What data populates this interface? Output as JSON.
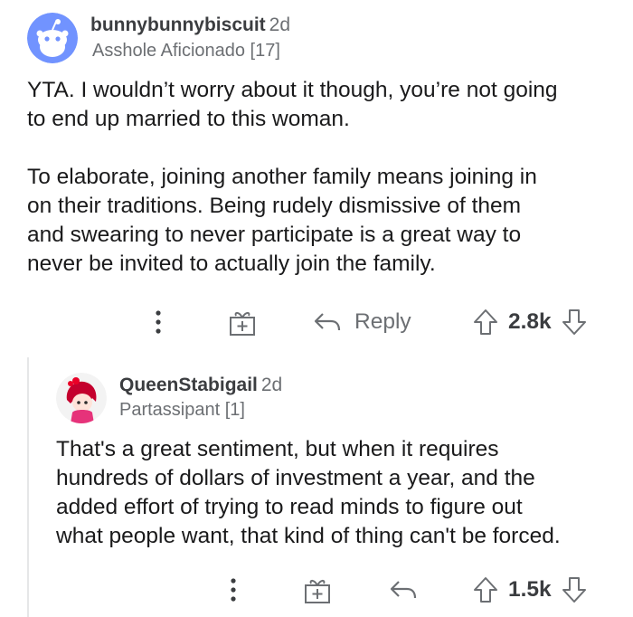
{
  "comments": [
    {
      "username": "bunnybunnybiscuit",
      "age": "2d",
      "flair": "Asshole Aficionado [17]",
      "paragraphs": [
        "YTA. I wouldn’t worry about it though, you’re not going\nto end up married to this woman.",
        "To elaborate, joining another family means joining in\non their traditions. Being rudely dismissive of them\nand swearing to never participate is a great way to\nnever be invited to actually join the family."
      ],
      "reply_label": "Reply",
      "score": "2.8k",
      "avatar_color": "#7193ff"
    },
    {
      "username": "QueenStabigail",
      "age": "2d",
      "flair": "Partassipant [1]",
      "paragraphs": [
        "That's a great sentiment, but when it requires\nhundreds of dollars of investment a year, and the\nadded effort of trying to read minds to figure out\nwhat people want, that kind of thing can't be forced."
      ],
      "score": "1.5k",
      "avatar_color": "#ea0027"
    }
  ],
  "icons": {
    "more": "more-options-icon",
    "award": "award-gift-icon",
    "reply": "reply-arrow-icon",
    "upvote": "upvote-arrow-icon",
    "downvote": "downvote-arrow-icon"
  }
}
